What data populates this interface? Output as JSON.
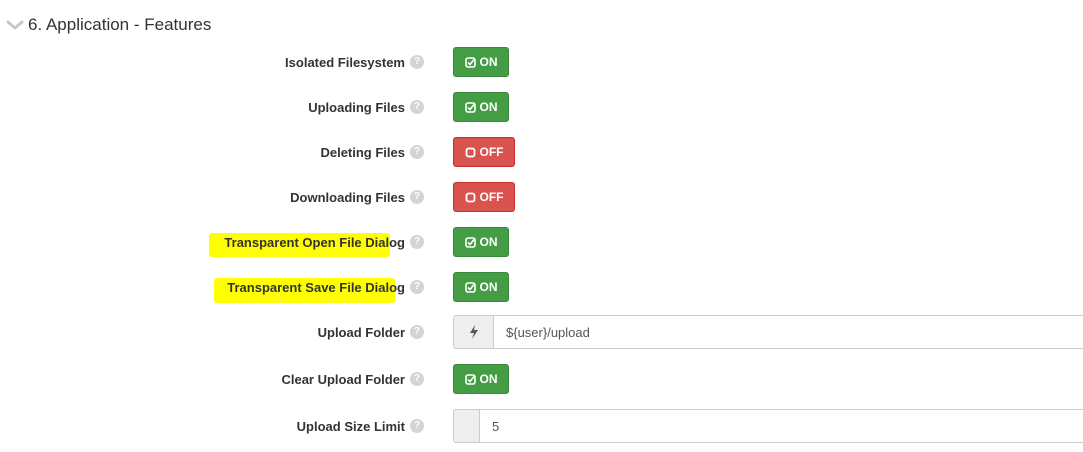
{
  "section": {
    "title": "6. Application - Features",
    "icon": "chevron-down-icon"
  },
  "settings": [
    {
      "label": "Isolated Filesystem",
      "type": "toggle",
      "state": "ON"
    },
    {
      "label": "Uploading Files",
      "type": "toggle",
      "state": "ON"
    },
    {
      "label": "Deleting Files",
      "type": "toggle",
      "state": "OFF"
    },
    {
      "label": "Downloading Files",
      "type": "toggle",
      "state": "OFF"
    },
    {
      "label": "Transparent Open File Dialog",
      "type": "toggle",
      "state": "ON",
      "highlighted": true
    },
    {
      "label": "Transparent Save File Dialog",
      "type": "toggle",
      "state": "ON",
      "highlighted": true
    },
    {
      "label": "Upload Folder",
      "type": "input",
      "value": "${user}/upload",
      "addon_icon": "lightning-bolt-icon"
    },
    {
      "label": "Clear Upload Folder",
      "type": "toggle",
      "state": "ON"
    },
    {
      "label": "Upload Size Limit",
      "type": "input",
      "value": "5",
      "addon_icon": ""
    }
  ],
  "help_glyph": "?",
  "colors": {
    "on": "#449d44",
    "off": "#d9534f",
    "highlight": "#ffff00"
  }
}
